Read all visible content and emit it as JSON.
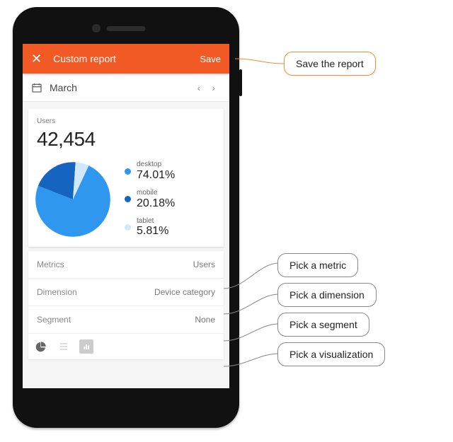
{
  "header": {
    "title": "Custom report",
    "save_label": "Save"
  },
  "date": {
    "month": "March"
  },
  "metric": {
    "label": "Users",
    "value": "42,454"
  },
  "chart_data": {
    "type": "pie",
    "title": "Users",
    "series": [
      {
        "name": "desktop",
        "value": 74.01,
        "display": "74.01%",
        "color": "#2f98ee"
      },
      {
        "name": "mobile",
        "value": 20.18,
        "display": "20.18%",
        "color": "#1565c0"
      },
      {
        "name": "tablet",
        "value": 5.81,
        "display": "5.81%",
        "color": "#cfe9fb"
      }
    ]
  },
  "rows": {
    "metrics": {
      "label": "Metrics",
      "value": "Users"
    },
    "dimension": {
      "label": "Dimension",
      "value": "Device category"
    },
    "segment": {
      "label": "Segment",
      "value": "None"
    }
  },
  "callouts": {
    "save": "Save the report",
    "metric": "Pick a metric",
    "dimension": "Pick a dimension",
    "segment": "Pick a segment",
    "viz": "Pick a visualization"
  }
}
